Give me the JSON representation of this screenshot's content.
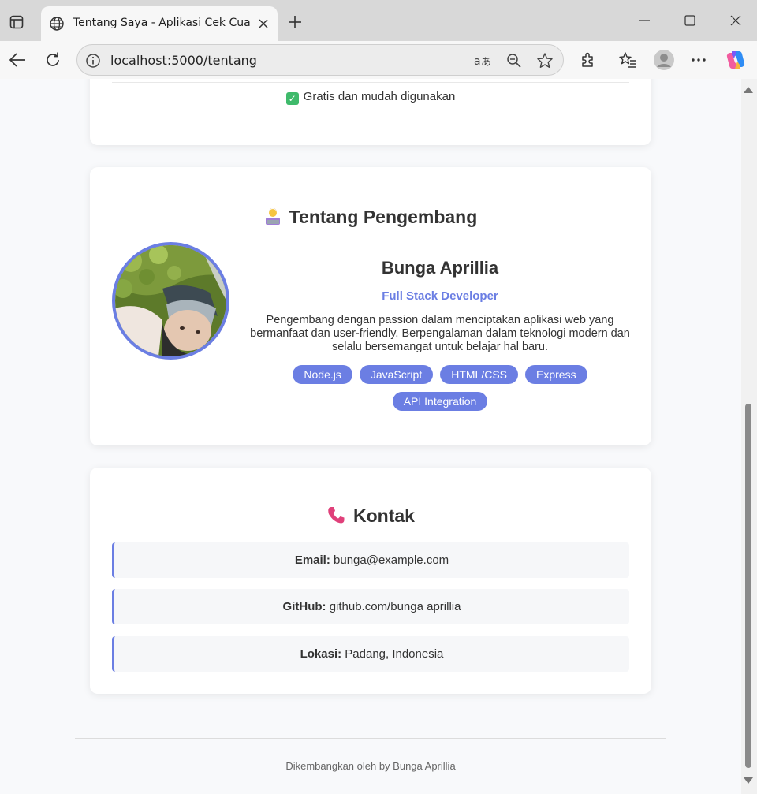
{
  "browser": {
    "tab_title": "Tentang Saya - Aplikasi Cek Cuaca",
    "url": "localhost:5000/tentang"
  },
  "features": {
    "last_item": "Gratis dan mudah digunakan"
  },
  "developer": {
    "section_title": "Tentang Pengembang",
    "name": "Bunga Aprillia",
    "role": "Full Stack Developer",
    "description": "Pengembang dengan passion dalam menciptakan aplikasi web yang bermanfaat dan user-friendly. Berpengalaman dalam teknologi modern dan selalu bersemangat untuk belajar hal baru.",
    "skills": [
      "Node.js",
      "JavaScript",
      "HTML/CSS",
      "Express",
      "API Integration"
    ]
  },
  "contact": {
    "section_title": "Kontak",
    "items": [
      {
        "label": "Email:",
        "value": "bunga@example.com"
      },
      {
        "label": "GitHub:",
        "value": "github.com/bunga aprillia"
      },
      {
        "label": "Lokasi:",
        "value": "Padang, Indonesia"
      }
    ]
  },
  "footer": {
    "text": "Dikembangkan oleh by Bunga Aprillia"
  },
  "colors": {
    "accent": "#6b7ee3",
    "page_bg": "#f8f9fb"
  },
  "icons": {
    "tab_favicon": "globe-icon",
    "feature_check": "check-mark-icon",
    "developer_section": "technologist-emoji-icon",
    "contact_section": "telephone-receiver-icon"
  }
}
